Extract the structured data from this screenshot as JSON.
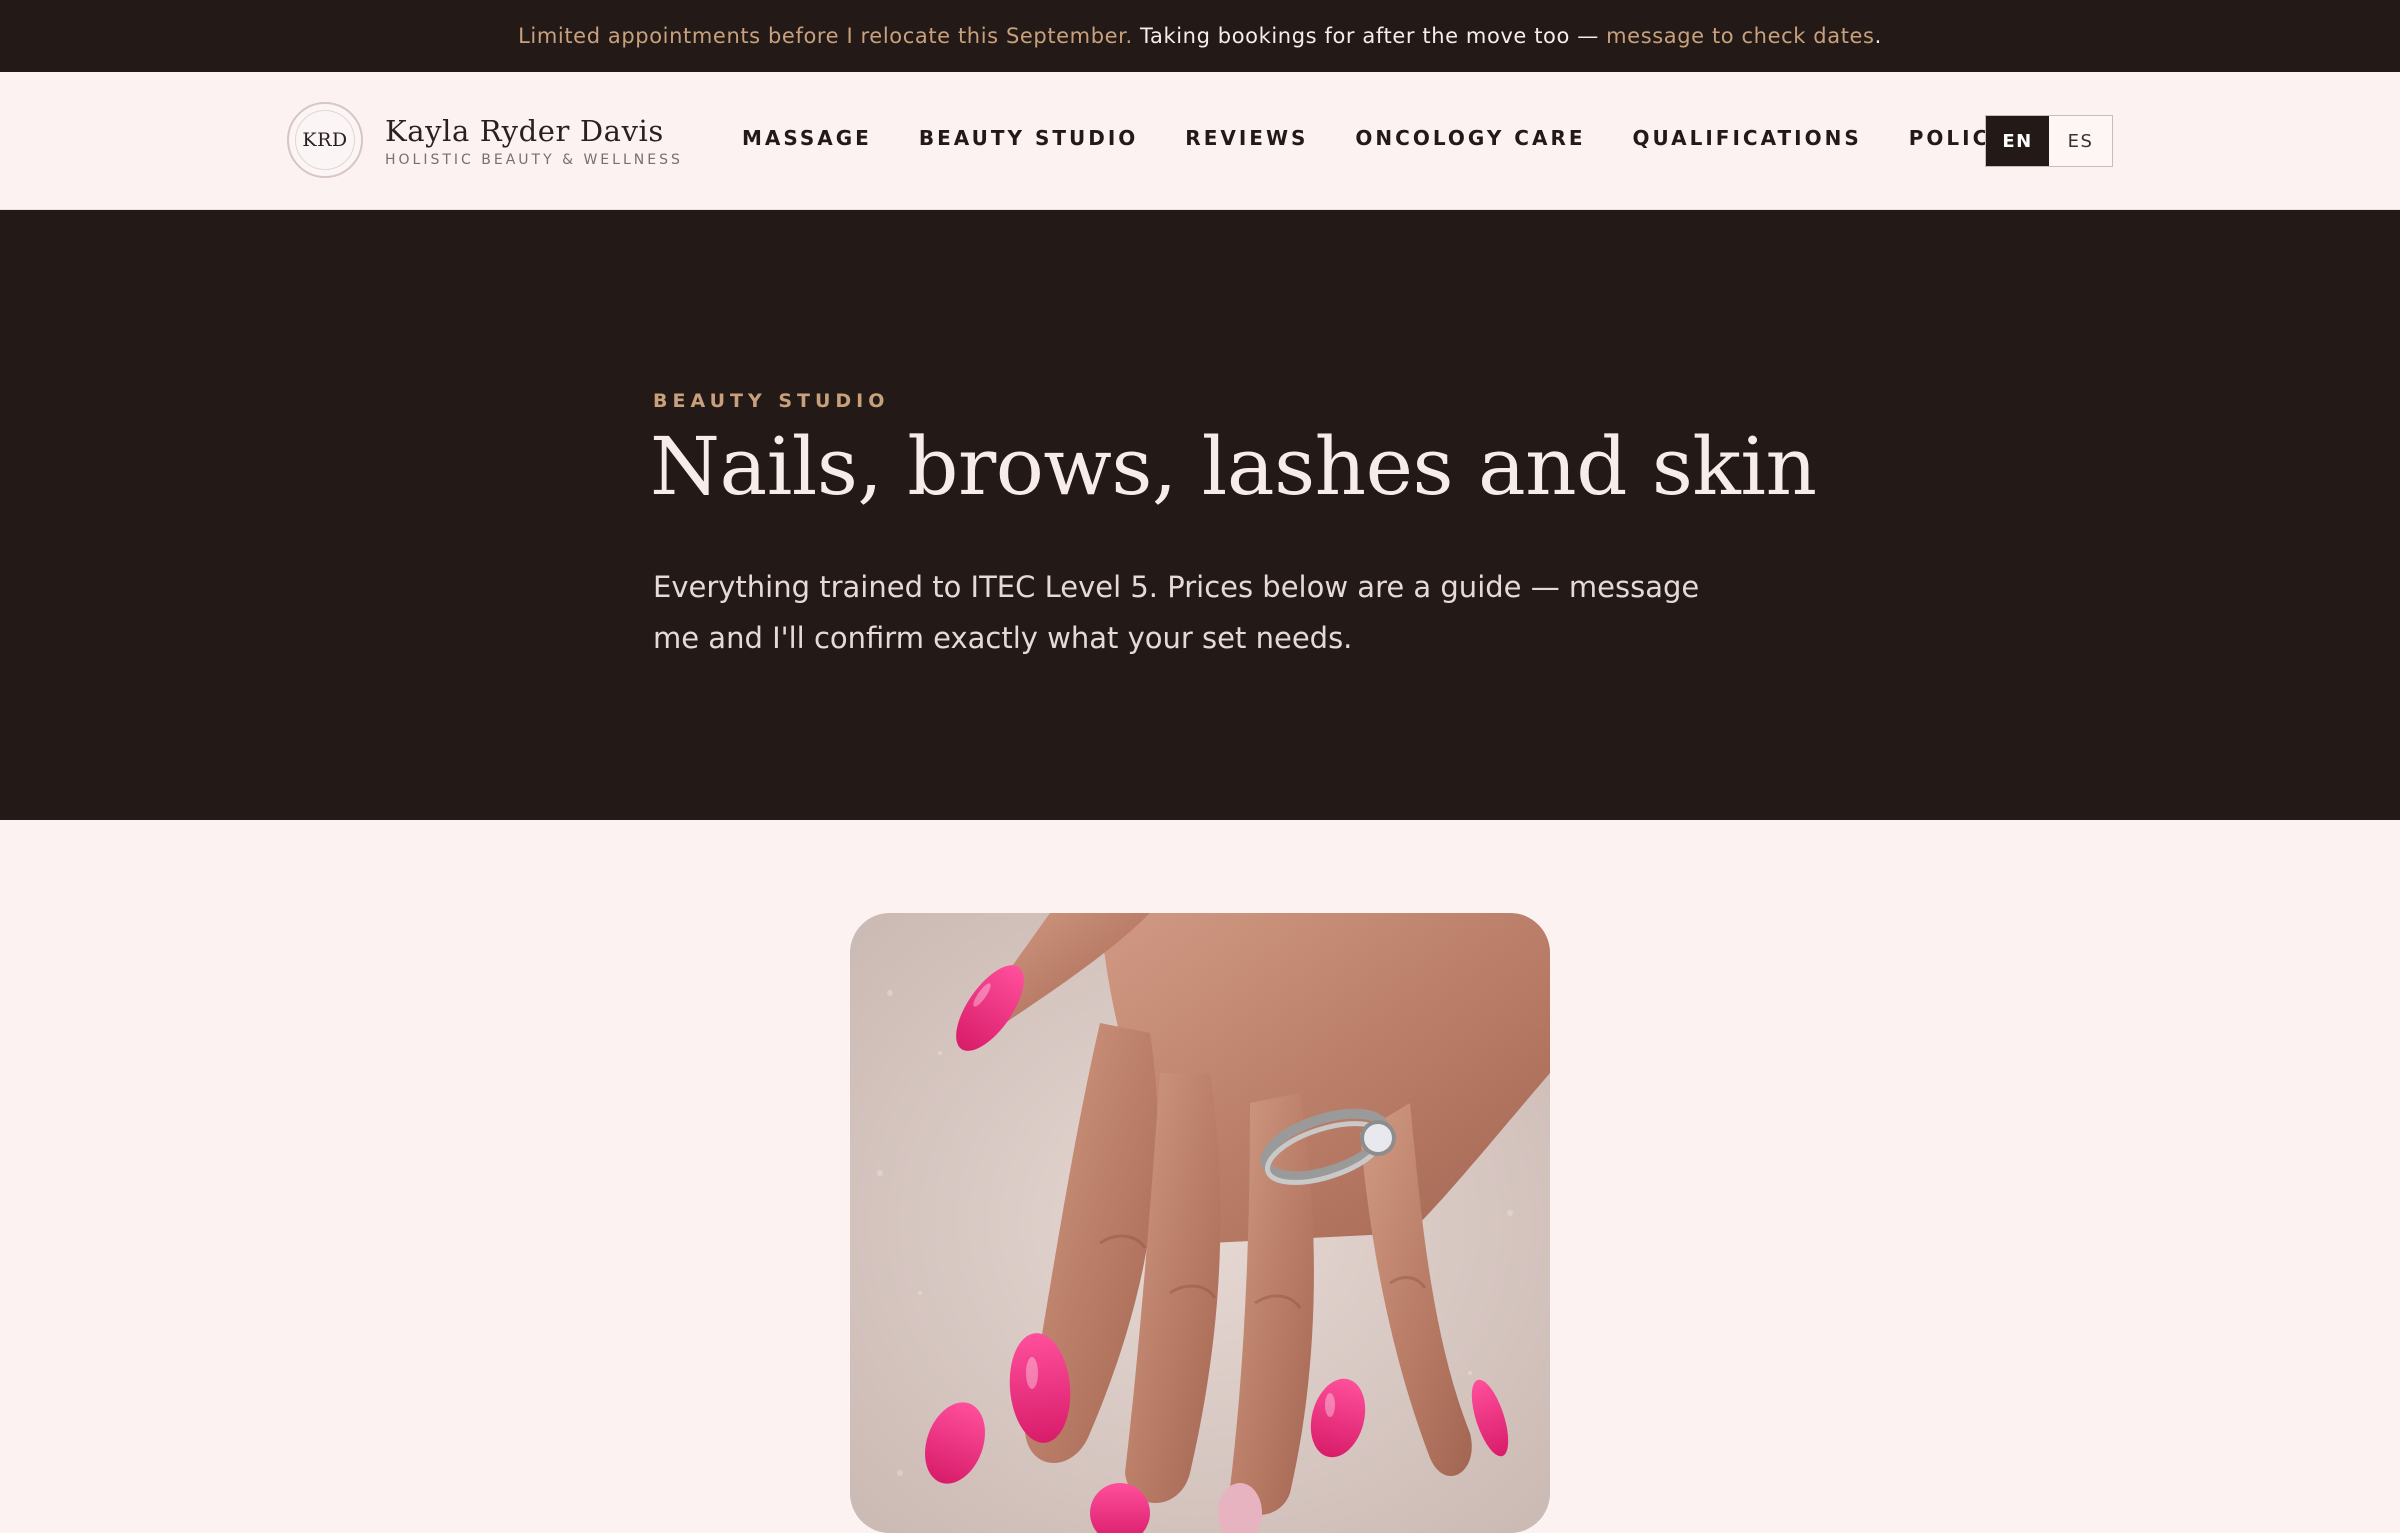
{
  "announcement": {
    "lead": "Limited appointments before I relocate this September.",
    "middle": "Taking bookings for after the move too —",
    "link": "message to check dates",
    "end": "."
  },
  "brand": {
    "monogram": "KRD",
    "name": "Kayla Ryder Davis",
    "tagline": "HOLISTIC BEAUTY & WELLNESS"
  },
  "nav": {
    "items": [
      {
        "label": "MASSAGE"
      },
      {
        "label": "BEAUTY STUDIO"
      },
      {
        "label": "REVIEWS"
      },
      {
        "label": "ONCOLOGY CARE"
      },
      {
        "label": "QUALIFICATIONS"
      },
      {
        "label": "POLICIES"
      }
    ]
  },
  "language": {
    "selected": "EN",
    "options": [
      "EN",
      "ES"
    ]
  },
  "hero": {
    "eyebrow": "BEAUTY STUDIO",
    "title": "Nails, brows, lashes and skin",
    "subtitle": "Everything trained to ITEC Level 5. Prices below are a guide — message me and I'll confirm exactly what your set needs."
  },
  "colors": {
    "dark": "#231a18",
    "gold": "#c9a07c",
    "blush": "#fdf2f2",
    "nail_pink": "#e8267a"
  },
  "photo": {
    "subject": "manicured-hand-pink-gel-nails-with-ring"
  }
}
